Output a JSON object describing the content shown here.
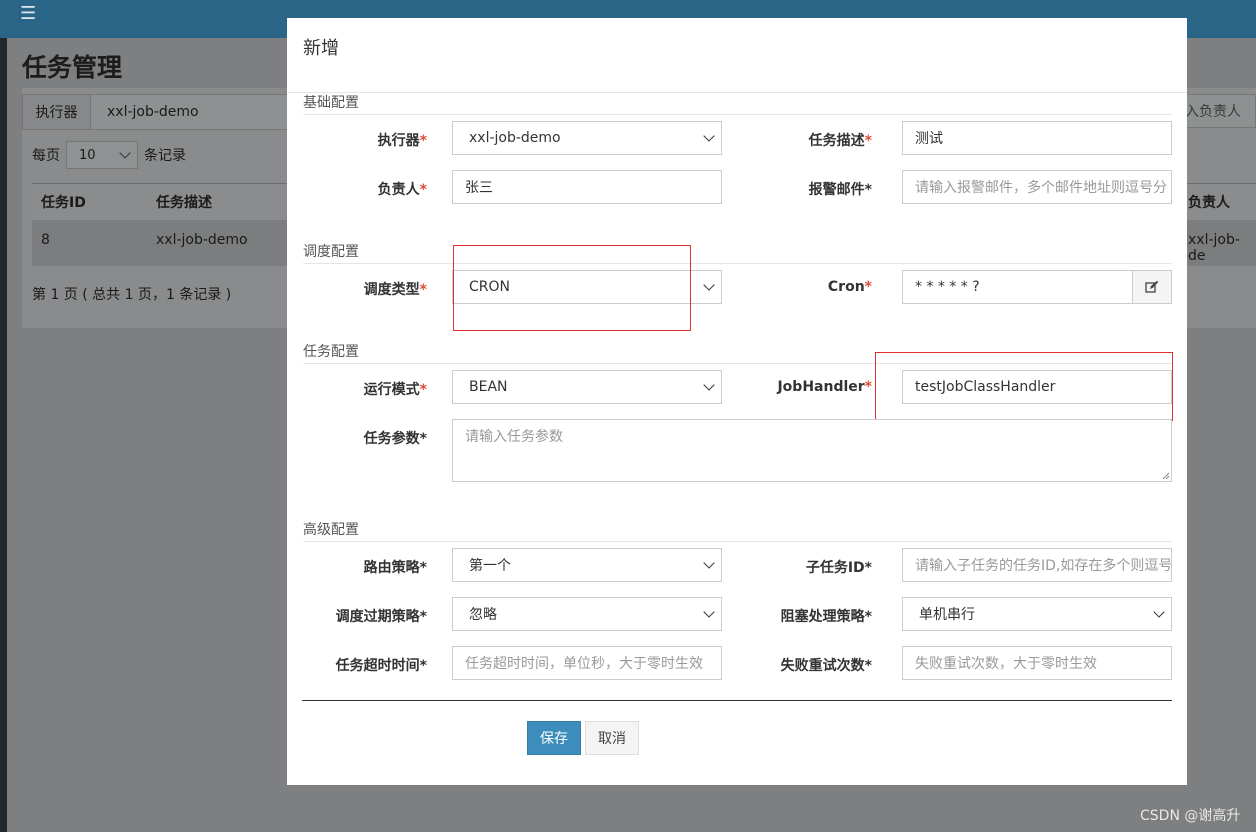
{
  "background": {
    "page_title": "任务管理",
    "filter": {
      "label": "执行器",
      "value": "xxl-job-demo",
      "right_placeholder": "入负责人"
    },
    "per_page": {
      "prefix": "每页",
      "value": "10",
      "suffix": "条记录"
    },
    "table": {
      "headers": [
        "任务ID",
        "任务描述",
        "负责人"
      ],
      "row": {
        "id": "8",
        "desc": "xxl-job-demo",
        "owner": "xxl-job-de"
      }
    },
    "pager": "第 1 页 ( 总共 1 页，1 条记录 )",
    "watermark": "CSDN @谢高升"
  },
  "modal": {
    "title": "新增",
    "sections": {
      "basic": "基础配置",
      "schedule": "调度配置",
      "task": "任务配置",
      "advanced": "高级配置"
    },
    "fields": {
      "executor": {
        "label": "执行器",
        "value": "xxl-job-demo"
      },
      "job_desc": {
        "label": "任务描述",
        "value": "测试"
      },
      "owner": {
        "label": "负责人",
        "value": "张三"
      },
      "alarm_email": {
        "label": "报警邮件*",
        "placeholder": "请输入报警邮件，多个邮件地址则逗号分"
      },
      "schedule_type": {
        "label": "调度类型",
        "value": "CRON"
      },
      "cron": {
        "label": "Cron",
        "value": "* * * * * ?"
      },
      "glue_type": {
        "label": "运行模式",
        "value": "BEAN"
      },
      "job_handler": {
        "label": "JobHandler",
        "value": "testJobClassHandler"
      },
      "job_param": {
        "label": "任务参数*",
        "placeholder": "请输入任务参数"
      },
      "route_strategy": {
        "label": "路由策略*",
        "value": "第一个"
      },
      "child_job": {
        "label": "子任务ID*",
        "placeholder": "请输入子任务的任务ID,如存在多个则逗号"
      },
      "misfire_strategy": {
        "label": "调度过期策略*",
        "value": "忽略"
      },
      "block_strategy": {
        "label": "阻塞处理策略*",
        "value": "单机串行"
      },
      "timeout": {
        "label": "任务超时时间*",
        "placeholder": "任务超时时间，单位秒，大于零时生效"
      },
      "fail_retry": {
        "label": "失败重试次数*",
        "placeholder": "失败重试次数，大于零时生效"
      }
    },
    "required_mark": "*",
    "buttons": {
      "save": "保存",
      "cancel": "取消"
    }
  },
  "colors": {
    "primary": "#3c8dbc",
    "topbar": "#2a6588",
    "highlight": "#e03131",
    "required": "#dd4b39"
  }
}
